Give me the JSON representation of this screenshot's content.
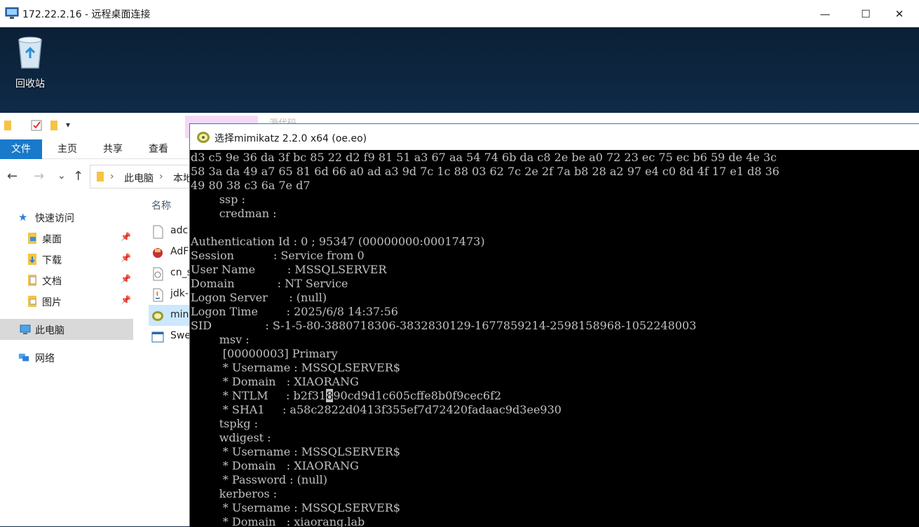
{
  "rdp_window": {
    "title": "172.22.2.16 - 远程桌面连接",
    "minimize_glyph": "—",
    "maximize_glyph": "☐",
    "close_glyph": "✕",
    "icon": "remote-desktop-icon"
  },
  "desktop": {
    "recycle_bin_label": "回收站",
    "recycle_bin_icon": "recycle-bin-icon"
  },
  "explorer": {
    "ribbon_tabs": [
      "文件",
      "主页",
      "共享",
      "查看"
    ],
    "address": {
      "segment1": "此电脑",
      "separator": "›",
      "segment2": "本地"
    },
    "nav_back": "←",
    "nav_forward": "→",
    "nav_recent": "⌄",
    "nav_up": "↑",
    "nav_pane": {
      "quick_access": "快速访问",
      "desktop": "桌面",
      "downloads": "下载",
      "documents": "文档",
      "pictures": "图片",
      "this_pc": "此电脑",
      "network": "网络",
      "pin_glyph": "📌"
    },
    "column_header_name": "名称",
    "files": [
      "adc",
      "AdF",
      "cn_s",
      "jdk-",
      "min",
      "Swe"
    ],
    "top_folder_label": "源代码"
  },
  "console": {
    "title": "选择mimikatz 2.2.0 x64 (oe.eo)",
    "icon": "mimikatz-icon",
    "lines": [
      "d3 c5 9e 36 da 3f bc 85 22 d2 f9 81 51 a3 67 aa 54 74 6b da c8 2e be a0 72 23 ec 75 ec b6 59 de 4e 3c",
      "58 3a da 49 a7 65 81 6d 66 a0 ad a3 9d 7c 1c 88 03 62 7c 2e 2f 7a b8 28 a2 97 e4 c0 8d 4f 17 e1 d8 36",
      "49 80 38 c3 6a 7e d7",
      "        ssp :",
      "        credman :",
      "",
      "Authentication Id : 0 ; 95347 (00000000:00017473)",
      "Session           : Service from 0",
      "User Name         : MSSQLSERVER",
      "Domain            : NT Service",
      "Logon Server      : (null)",
      "Logon Time        : 2025/6/8 14:37:56",
      "SID               : S-1-5-80-3880718306-3832830129-1677859214-2598158968-1052248003",
      "        msv :",
      "         [00000003] Primary",
      "         * Username : MSSQLSERVER$",
      "         * Domain   : XIAORANG",
      "         * NTLM     : b2f31890cd9d1c605cffe8b0f9cec6f2",
      "         * SHA1     : a58c2822d0413f355ef7d72420fadaac9d3ee930",
      "        tspkg :",
      "        wdigest :",
      "         * Username : MSSQLSERVER$",
      "         * Domain   : XIAORANG",
      "         * Password : (null)",
      "        kerberos :",
      "         * Username : MSSQLSERVER$",
      "         * Domain   : xiaorang.lab"
    ]
  }
}
